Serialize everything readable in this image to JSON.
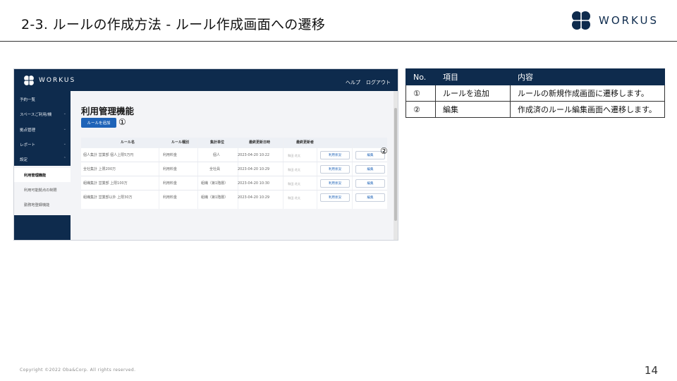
{
  "slide": {
    "title": "2-3. ルールの作成方法 - ルール作成画面への遷移",
    "logo_text": "WORKUS",
    "copyright": "Copyright ©2022 Oba&Corp. All rights reserved.",
    "page_number": "14"
  },
  "app": {
    "logo_text": "WORKUS",
    "top_links": [
      "ヘルプ",
      "ログアウト"
    ],
    "sidebar": {
      "items": [
        "予約一覧",
        "スペースご利用/機",
        "拠点管理",
        "レポート",
        "設定"
      ],
      "sub_items": [
        "利用管理機能",
        "利用可能拠点の制限",
        "勤務地登録機能"
      ],
      "active_sub_item": "利用管理機能"
    },
    "page_heading": "利用管理機能",
    "add_rule_button": "ルールを追加",
    "marker_1": "①",
    "marker_2": "②",
    "table": {
      "columns": [
        "ルール名",
        "ルール種別",
        "集計単位",
        "最終更新日時",
        "最終更新者",
        "",
        ""
      ],
      "rows": [
        {
          "name": "個人集計  営業部  個人上限5万円",
          "type": "利用料金",
          "unit": "個人",
          "updated_at": "2023-04-20 10:22",
          "updated_by": "和田 花太",
          "status_btn": "利用状況",
          "edit_btn": "編集"
        },
        {
          "name": "全社集計  上限200万",
          "type": "利用料金",
          "unit": "全社員",
          "updated_at": "2023-04-20 10:29",
          "updated_by": "和田 花太",
          "status_btn": "利用状況",
          "edit_btn": "編集"
        },
        {
          "name": "組織集計  営業部  上限100万",
          "type": "利用料金",
          "unit": "組織（第1階層）",
          "updated_at": "2023-04-20 10:30",
          "updated_by": "和田 花太",
          "status_btn": "利用状況",
          "edit_btn": "編集"
        },
        {
          "name": "組織集計  営業部以外  上限30万",
          "type": "利用料金",
          "unit": "組織（第1階層）",
          "updated_at": "2023-04-20 10:29",
          "updated_by": "和田 花太",
          "status_btn": "利用状況",
          "edit_btn": "編集"
        }
      ]
    }
  },
  "info_table": {
    "headers": [
      "No.",
      "項目",
      "内容"
    ],
    "rows": [
      {
        "no": "①",
        "item": "ルールを追加",
        "content": "ルールの新規作成画面に遷移します。"
      },
      {
        "no": "②",
        "item": "編集",
        "content": "作成済のルール編集画面へ遷移します。"
      }
    ]
  },
  "colors": {
    "navy": "#0e2b4d",
    "accent_blue": "#1e63b8"
  }
}
